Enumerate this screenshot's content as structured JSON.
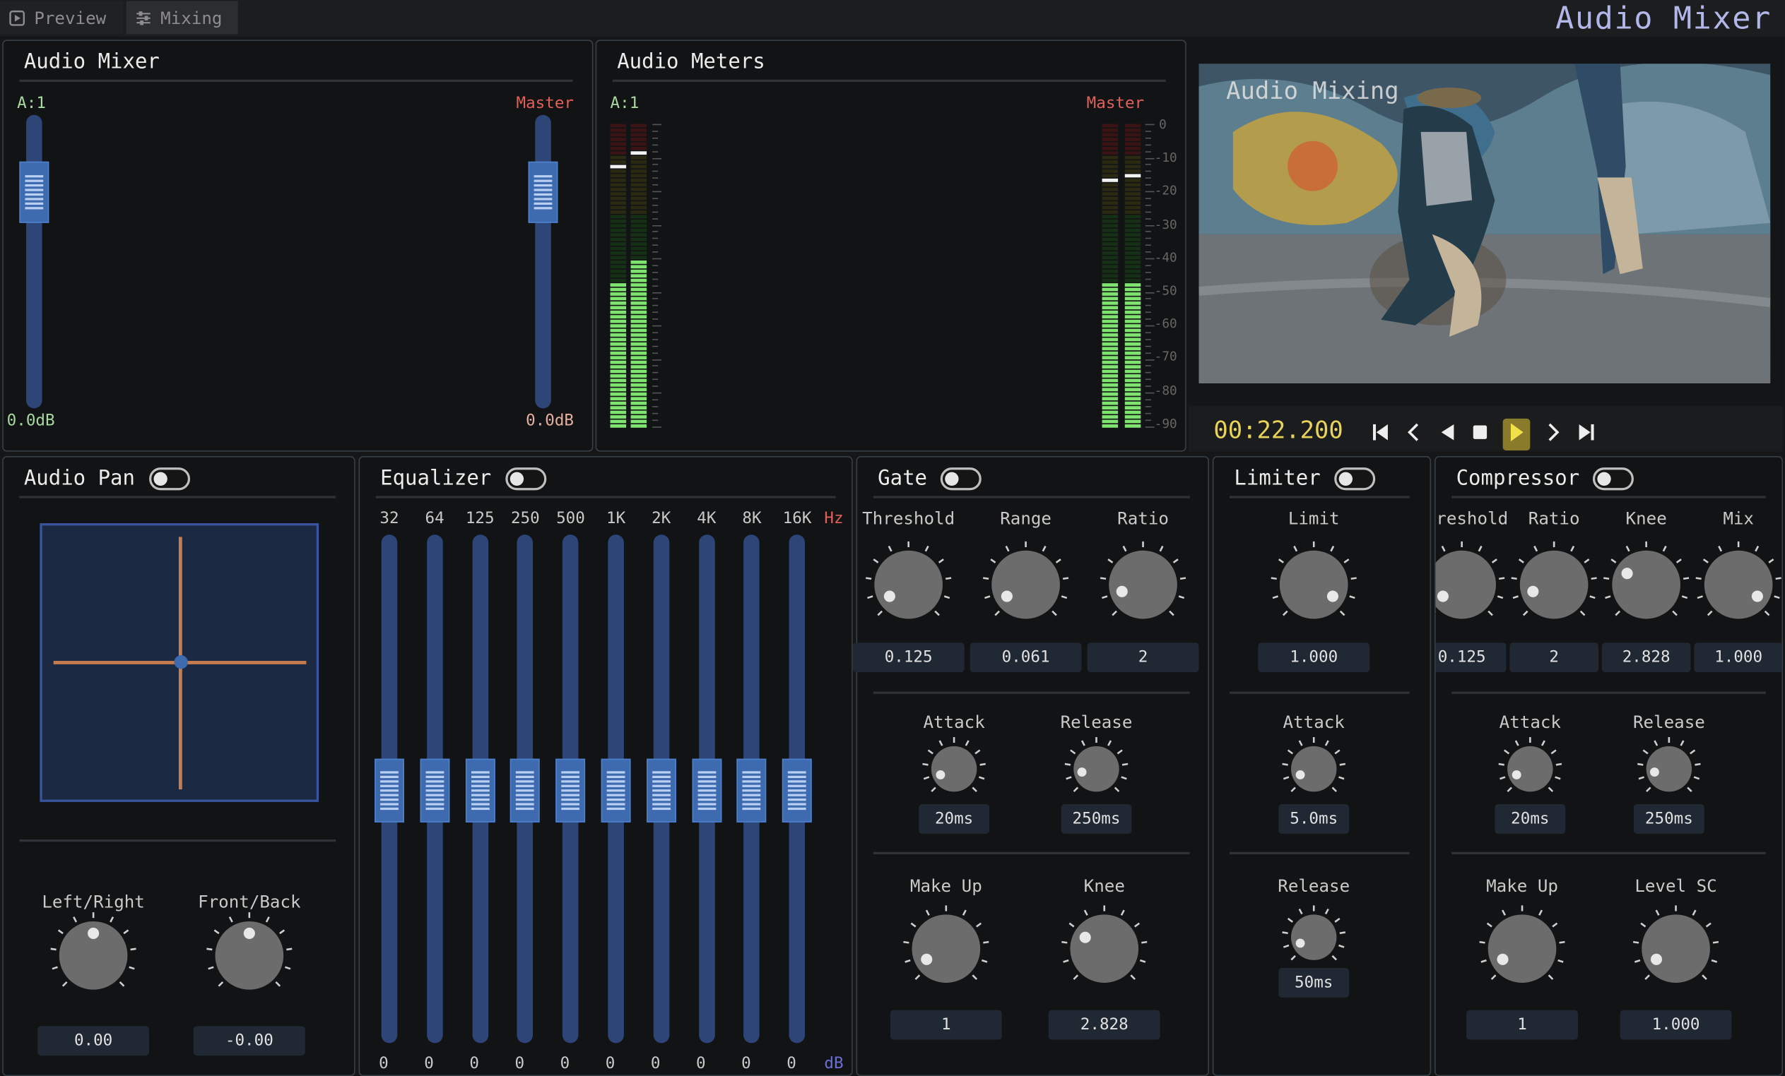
{
  "app": {
    "title": "Audio Mixer"
  },
  "tabs": [
    {
      "label": "Preview",
      "icon": "play-icon"
    },
    {
      "label": "Mixing",
      "icon": "sliders-icon"
    }
  ],
  "colors": {
    "accent": "#3e6bb0",
    "panel_border": "#364046",
    "meter_green": "#7ee36f",
    "master_label": "#e0605a",
    "track_label": "#a8d9a0",
    "timecode": "#e8d35a",
    "crosshair": "#c67c4e"
  },
  "audio_mixer": {
    "title": "Audio Mixer",
    "channels": [
      {
        "label": "A:1",
        "value": "0.0dB",
        "level": 0.8
      },
      {
        "label": "Master",
        "value": "0.0dB",
        "level": 0.8
      }
    ]
  },
  "audio_meters": {
    "title": "Audio Meters",
    "channel_label": "A:1",
    "master_label": "Master",
    "scale": [
      "0",
      "-10",
      "-20",
      "-30",
      "-40",
      "-50",
      "-60",
      "-70",
      "-80",
      "-90"
    ],
    "a1_levels": [
      0.48,
      0.56
    ],
    "a1_peaks": [
      0.87,
      0.91
    ],
    "master_levels": [
      0.48,
      0.48
    ],
    "master_peaks": [
      0.82,
      0.83
    ]
  },
  "preview": {
    "overlay_text": "Audio Mixing",
    "timecode": "00:22.200",
    "controls": [
      "skip-start-icon",
      "step-back-icon",
      "play-reverse-icon",
      "stop-icon",
      "play-icon",
      "step-forward-icon",
      "skip-end-icon"
    ]
  },
  "audio_pan": {
    "title": "Audio Pan",
    "knobs": [
      {
        "label": "Left/Right",
        "value": "0.00",
        "position": 0.5
      },
      {
        "label": "Front/Back",
        "value": "-0.00",
        "position": 0.5
      }
    ]
  },
  "equalizer": {
    "title": "Equalizer",
    "unit_freq": "Hz",
    "unit_gain": "dB",
    "bands": [
      {
        "freq": "32",
        "gain": "0"
      },
      {
        "freq": "64",
        "gain": "0"
      },
      {
        "freq": "125",
        "gain": "0"
      },
      {
        "freq": "250",
        "gain": "0"
      },
      {
        "freq": "500",
        "gain": "0"
      },
      {
        "freq": "1K",
        "gain": "0"
      },
      {
        "freq": "2K",
        "gain": "0"
      },
      {
        "freq": "4K",
        "gain": "0"
      },
      {
        "freq": "8K",
        "gain": "0"
      },
      {
        "freq": "16K",
        "gain": "0"
      }
    ]
  },
  "gate": {
    "title": "Gate",
    "row1": [
      {
        "label": "Threshold",
        "value": "0.125",
        "position": 0.05
      },
      {
        "label": "Range",
        "value": "0.061",
        "position": 0.05
      },
      {
        "label": "Ratio",
        "value": "2",
        "position": 0.1
      }
    ],
    "row2": [
      {
        "label": "Attack",
        "value": "20ms",
        "position": 0.08
      },
      {
        "label": "Release",
        "value": "250ms",
        "position": 0.12
      }
    ],
    "row3": [
      {
        "label": "Make Up",
        "value": "1",
        "position": 0.06
      },
      {
        "label": "Knee",
        "value": "2.828",
        "position": 0.28
      }
    ]
  },
  "limiter": {
    "title": "Limiter",
    "row1": [
      {
        "label": "Limit",
        "value": "1.000",
        "position": 0.95
      }
    ],
    "row2": [
      {
        "label": "Attack",
        "value": "5.0ms",
        "position": 0.08
      }
    ],
    "row3": [
      {
        "label": "Release",
        "value": "50ms",
        "position": 0.08
      }
    ]
  },
  "compressor": {
    "title": "Compressor",
    "row1": [
      {
        "label": "Threshold",
        "value": "0.125",
        "position": 0.05
      },
      {
        "label": "Ratio",
        "value": "2",
        "position": 0.1
      },
      {
        "label": "Knee",
        "value": "2.828",
        "position": 0.28
      },
      {
        "label": "Mix",
        "value": "1.000",
        "position": 0.95
      }
    ],
    "row2": [
      {
        "label": "Attack",
        "value": "20ms",
        "position": 0.08
      },
      {
        "label": "Release",
        "value": "250ms",
        "position": 0.12
      }
    ],
    "row3": [
      {
        "label": "Make Up",
        "value": "1",
        "position": 0.06
      },
      {
        "label": "Level SC",
        "value": "1.000",
        "position": 0.06
      }
    ]
  }
}
